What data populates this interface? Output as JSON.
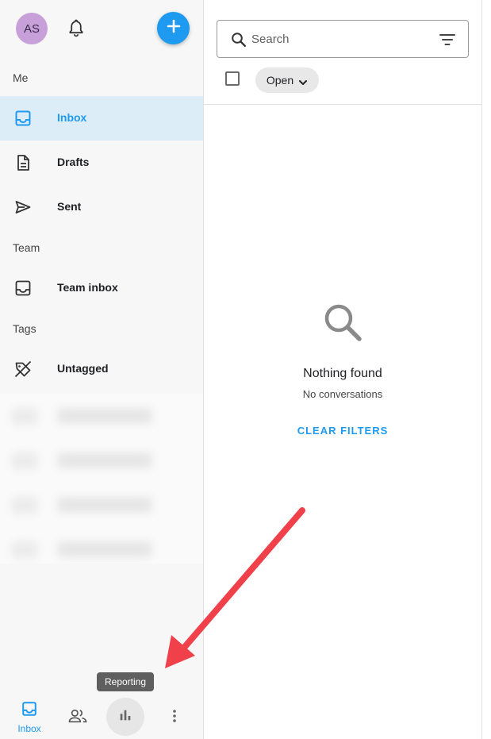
{
  "header": {
    "avatar_initials": "AS",
    "bell_icon": "bell-icon",
    "compose_icon": "plus-icon"
  },
  "sidebar": {
    "sections": {
      "me": "Me",
      "team": "Team",
      "tags": "Tags"
    },
    "items": [
      {
        "label": "Inbox",
        "icon": "inbox-icon",
        "active": true
      },
      {
        "label": "Drafts",
        "icon": "document-icon",
        "active": false
      },
      {
        "label": "Sent",
        "icon": "send-icon",
        "active": false
      },
      {
        "label": "Team inbox",
        "icon": "inbox-icon",
        "active": false
      },
      {
        "label": "Untagged",
        "icon": "tag-off-icon",
        "active": false
      }
    ]
  },
  "bottom_nav": {
    "inbox_label": "Inbox",
    "reporting_tooltip": "Reporting",
    "icons": [
      "inbox-icon",
      "people-icon",
      "bar-chart-icon",
      "more-vert-icon"
    ]
  },
  "main": {
    "search_placeholder": "Search",
    "status_filter": "Open",
    "empty_title": "Nothing found",
    "empty_subtitle": "No conversations",
    "clear_filters_label": "CLEAR FILTERS"
  },
  "colors": {
    "accent": "#1e9af0",
    "active_bg": "#dcedf8",
    "avatar_bg": "#c7a0d9",
    "annotation_arrow": "#f0414b"
  }
}
